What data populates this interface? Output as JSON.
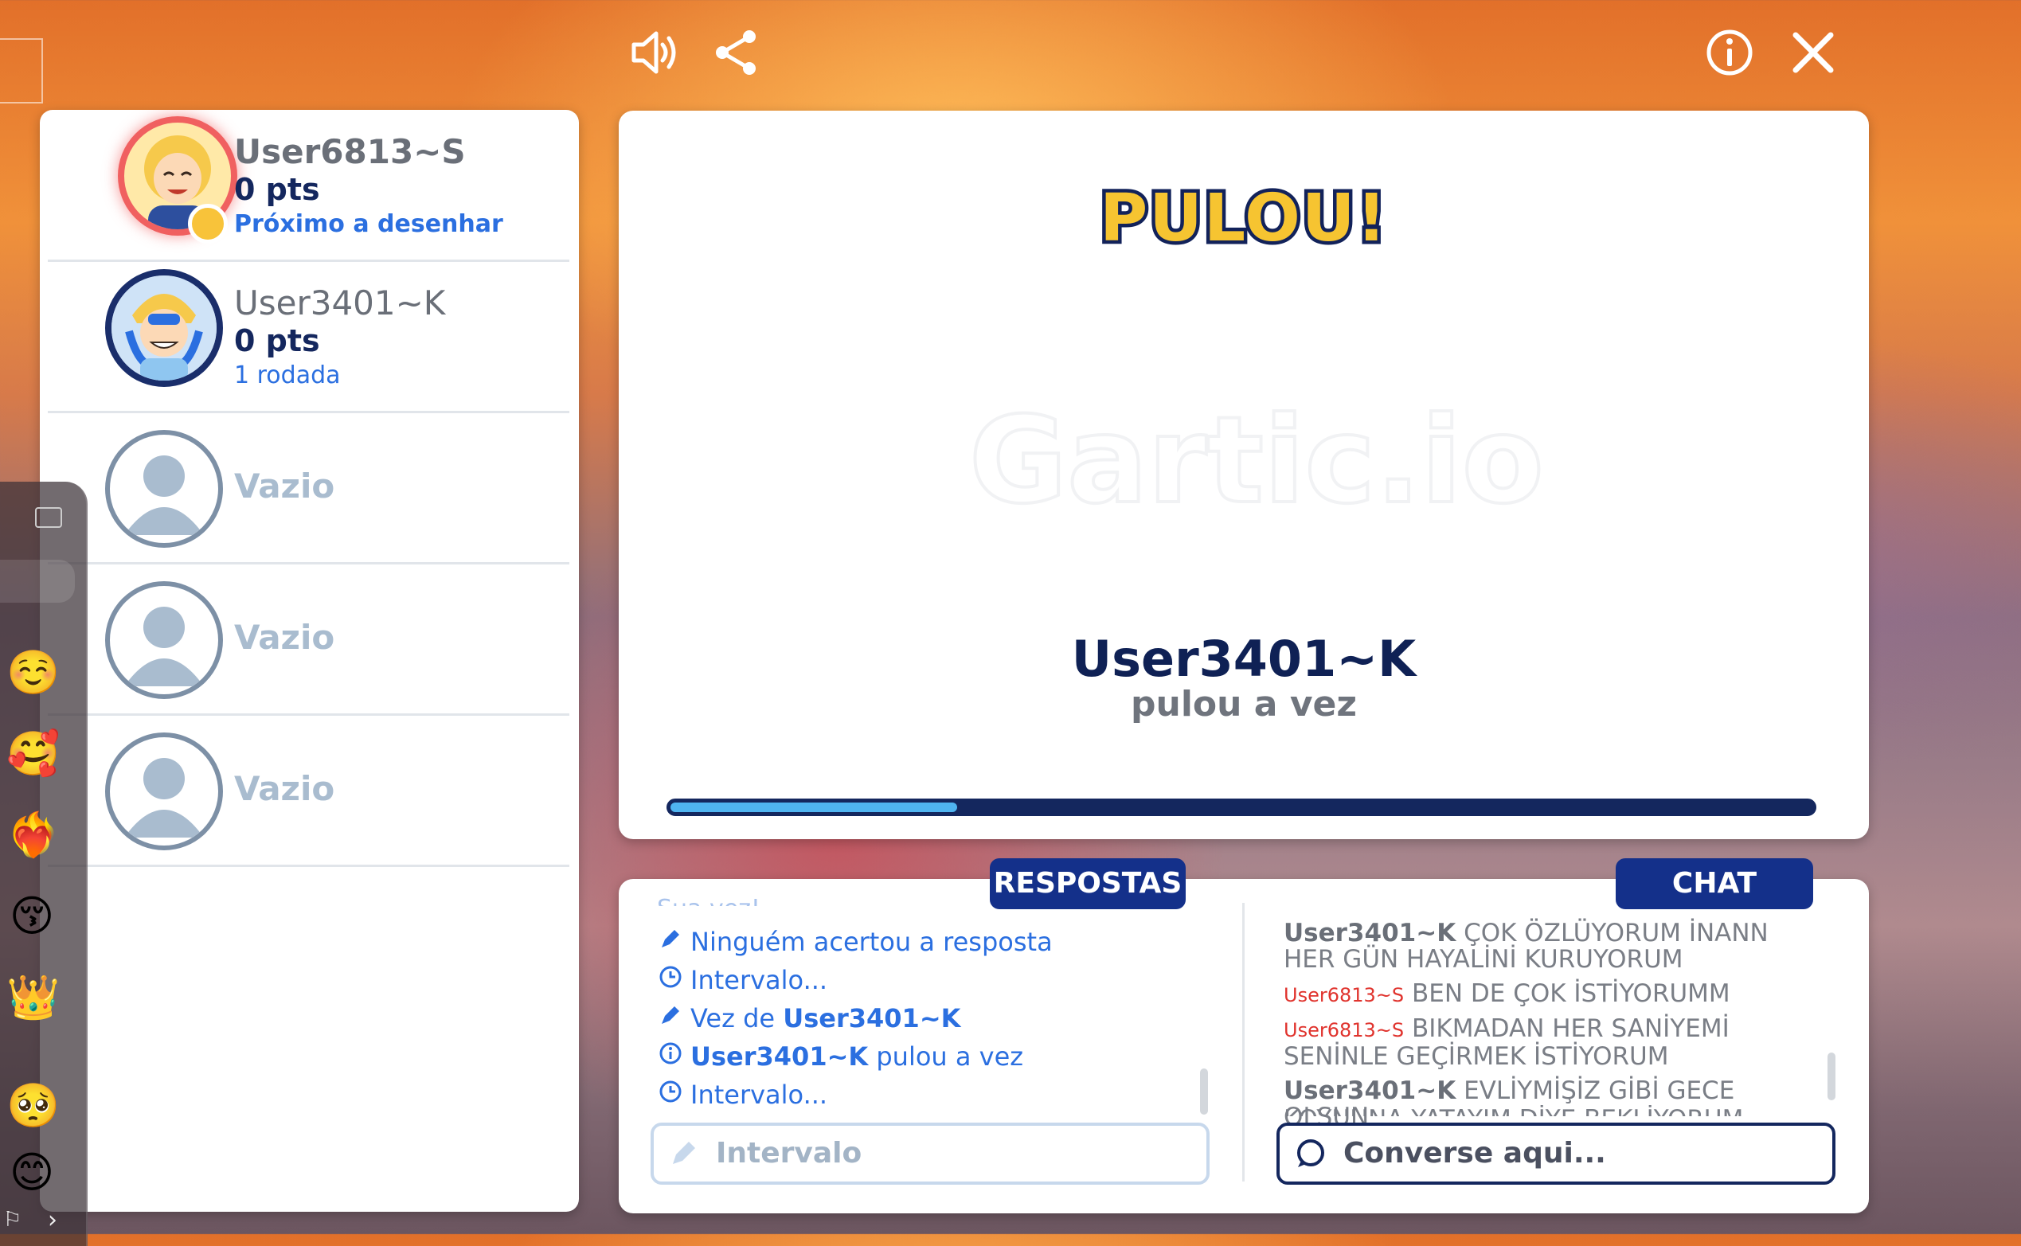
{
  "players": [
    {
      "name": "User6813~S",
      "points": "0 pts",
      "status": "Próximo a desenhar"
    },
    {
      "name": "User3401~K",
      "points": "0 pts",
      "status": "1 rodada"
    },
    {
      "empty_label": "Vazio"
    },
    {
      "empty_label": "Vazio"
    },
    {
      "empty_label": "Vazio"
    }
  ],
  "board": {
    "title": "PULOU!",
    "watermark": "Gartic.io",
    "skipped_user": "User3401~K",
    "skipped_text": "pulou a vez",
    "progress": 0.25
  },
  "tabs": {
    "answers": "RESPOSTAS",
    "chat": "CHAT"
  },
  "answers": {
    "cut_top": "Sua vez!",
    "lines": [
      {
        "icon": "pencil-icon",
        "text": "Ninguém acertou a resposta"
      },
      {
        "icon": "clock-icon",
        "text": "Intervalo..."
      },
      {
        "icon": "pencil-icon",
        "prefix": "Vez de ",
        "user": "User3401~K"
      },
      {
        "icon": "info-icon",
        "user": "User3401~K",
        "suffix": " pulou a vez"
      },
      {
        "icon": "clock-icon",
        "text": "Intervalo..."
      }
    ],
    "input_placeholder": "Intervalo"
  },
  "chat": {
    "messages": [
      {
        "user": "User3401~K",
        "text": " ÇOK ÖZLÜYORUM İNANN HER GÜN HAYALİNİ KURUYORUM"
      },
      {
        "user": "User6813~S",
        "text": " BEN DE ÇOK İSTİYORUMM"
      },
      {
        "user": "User6813~S",
        "text": " BIKMADAN HER SANİYEMİ SENİNLE GEÇİRMEK İSTİYORUM"
      },
      {
        "user": "User3401~K",
        "text": " EVLİYMİŞİZ GİBİ GECE OLSUN"
      }
    ],
    "cut_bottom": "KOYNUNA YATAYIM DİYE BEKLİYORUM",
    "input_placeholder": "Converse aqui..."
  },
  "emoji_strip": [
    "☺️",
    "🥰",
    "❤️‍🔥",
    "😚",
    "👑",
    "🥺",
    "😊"
  ],
  "colors": {
    "navy": "#14275e",
    "accent_blue": "#2b6fe0",
    "title_yellow": "#f6c431",
    "progress_fill": "#4fb4f0"
  }
}
